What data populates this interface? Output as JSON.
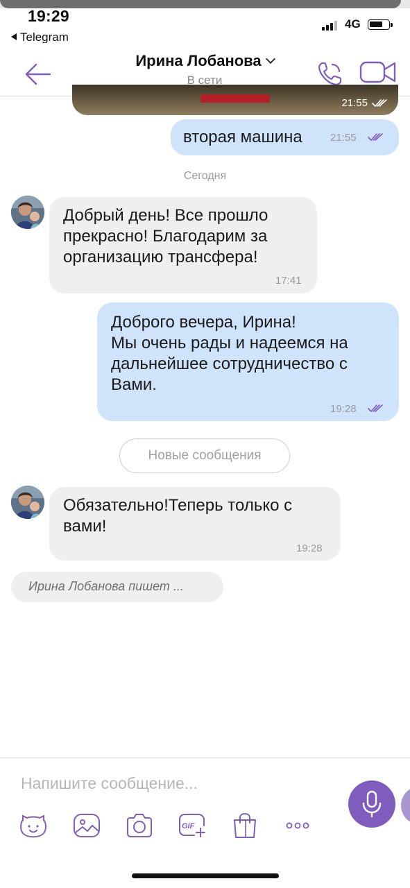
{
  "status_bar": {
    "time": "19:29",
    "back_app": "Telegram",
    "network": "4G"
  },
  "header": {
    "contact_name": "Ирина Лобанова",
    "contact_status": "В сети",
    "back_icon": "back-arrow-icon",
    "call_icon": "phone-icon",
    "video_icon": "video-camera-icon"
  },
  "chat": {
    "image_message": {
      "time": "21:55"
    },
    "messages_before": [
      {
        "direction": "out",
        "text": "вторая машина",
        "time": "21:55",
        "read": true
      }
    ],
    "day_separator": "Сегодня",
    "messages_today": [
      {
        "direction": "in",
        "text": "Добрый день! Все прошло прекрасно! Благодарим за организацию трансфера!",
        "time": "17:41"
      },
      {
        "direction": "out",
        "text": "Доброго вечера, Ирина!\nМы очень рады и надеемся на дальнейшее сотрудничество с Вами.",
        "time": "19:28",
        "read": true
      }
    ],
    "new_messages_label": "Новые сообщения",
    "messages_new": [
      {
        "direction": "in",
        "text": "Обязательно!Теперь только с вами!",
        "time": "19:28"
      }
    ],
    "typing_indicator": "Ирина Лобанова пишет ..."
  },
  "composer": {
    "placeholder": "Напишите сообщение...",
    "tools": [
      "sticker-icon",
      "gallery-icon",
      "camera-icon",
      "gif-icon",
      "shopping-bag-icon",
      "more-icon"
    ],
    "send_icon": "microphone-icon"
  },
  "colors": {
    "accent": "#7f5dbd",
    "outgoing_bubble": "#cfe3fb",
    "incoming_bubble": "#efefef"
  }
}
